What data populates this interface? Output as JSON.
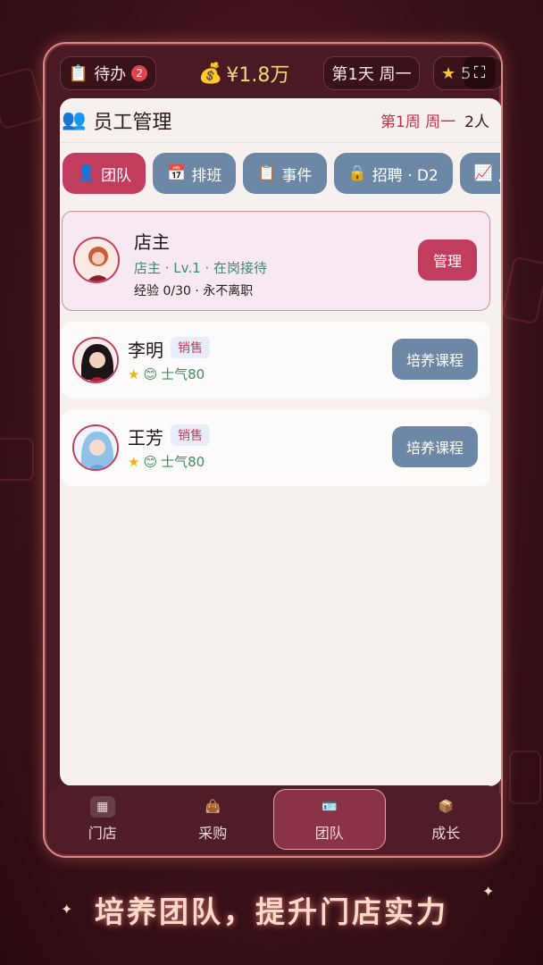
{
  "topbar": {
    "todo_label": "待办",
    "todo_count": "2",
    "money": "¥1.8万",
    "day_label": "第1天 周一",
    "star_value": "5"
  },
  "panel": {
    "title": "员工管理",
    "week": "第1周 周一",
    "headcount": "2人"
  },
  "tabs": [
    {
      "label": "团队",
      "icon": "person-icon"
    },
    {
      "label": "排班",
      "icon": "calendar-icon"
    },
    {
      "label": "事件",
      "icon": "clipboard-icon"
    },
    {
      "label": "招聘 · D2",
      "icon": "lock-icon"
    },
    {
      "label": "成长",
      "icon": "chart-icon"
    }
  ],
  "owner": {
    "name": "店主",
    "info": "店主 · Lv.1 · 在岗接待",
    "exp": "经验 0/30 · 永不离职",
    "button": "管理"
  },
  "employees": [
    {
      "name": "李明",
      "role": "销售",
      "morale": "士气80",
      "button": "培养课程"
    },
    {
      "name": "王芳",
      "role": "销售",
      "morale": "士气80",
      "button": "培养课程"
    }
  ],
  "nav": [
    {
      "label": "门店"
    },
    {
      "label": "采购"
    },
    {
      "label": "团队"
    },
    {
      "label": "成长"
    }
  ],
  "slogan": "培养团队，提升门店实力",
  "colors": {
    "accent": "#c23c5e",
    "secondary": "#6d88a6",
    "morale": "#3c8a6a"
  }
}
